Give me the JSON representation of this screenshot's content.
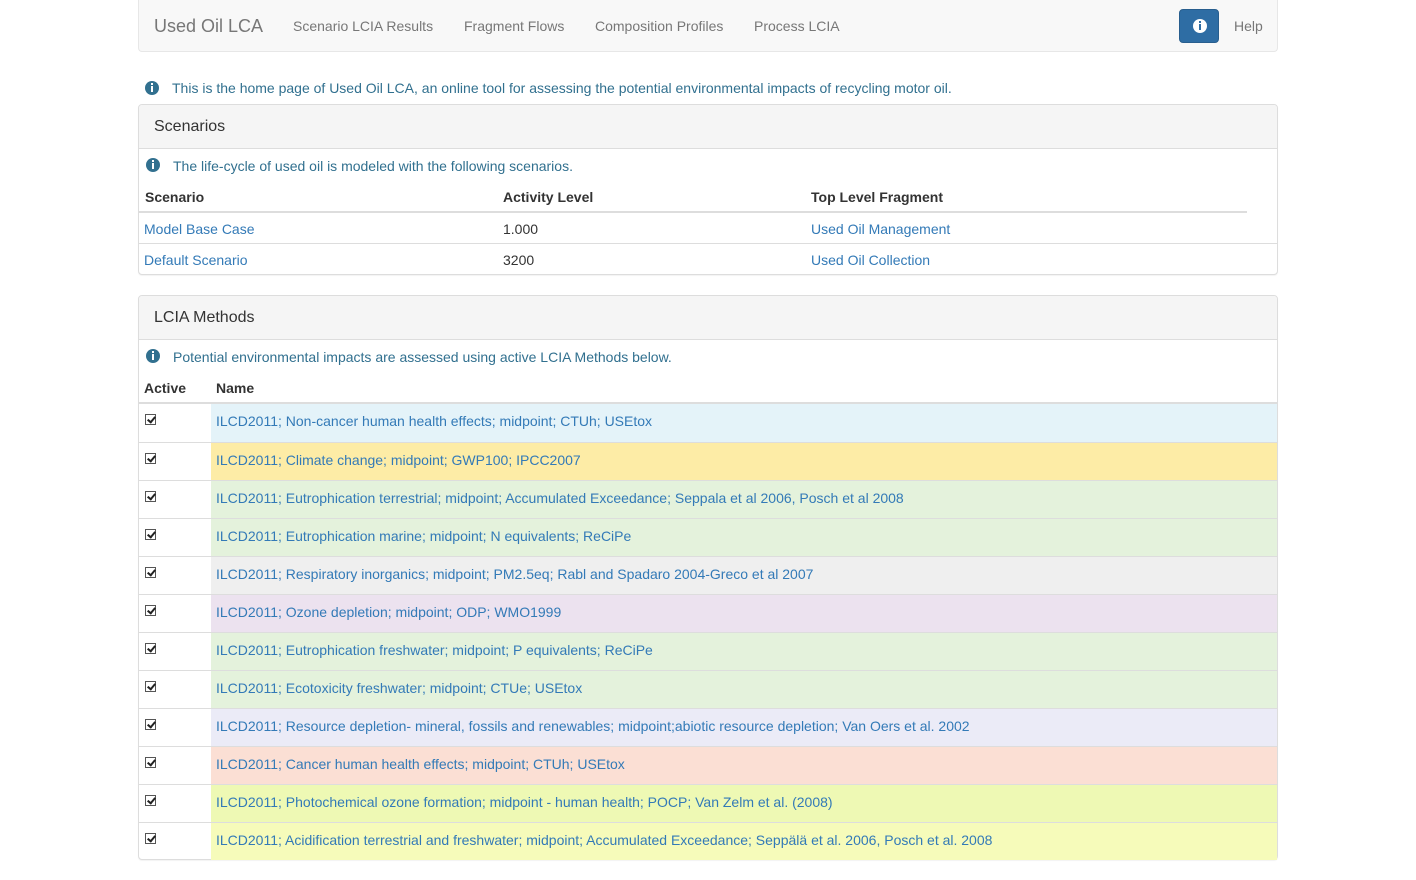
{
  "navbar": {
    "brand": "Used Oil LCA",
    "links": [
      "Scenario LCIA Results",
      "Fragment Flows",
      "Composition Profiles",
      "Process LCIA"
    ],
    "help": "Help",
    "info_icon": "info-sign-icon"
  },
  "intro": "This is the home page of Used Oil LCA, an online tool for assessing the potential environmental impacts of recycling motor oil.",
  "scenarios": {
    "title": "Scenarios",
    "note": "The life-cycle of used oil is modeled with the following scenarios.",
    "headers": [
      "Scenario",
      "Activity Level",
      "Top Level Fragment"
    ],
    "rows": [
      {
        "scenario": "Model Base Case",
        "activity": "1.000",
        "fragment": "Used Oil Management"
      },
      {
        "scenario": "Default Scenario",
        "activity": "3200",
        "fragment": "Used Oil Collection"
      }
    ]
  },
  "lcia": {
    "title": "LCIA Methods",
    "note": "Potential environmental impacts are assessed using active LCIA Methods below.",
    "headers": [
      "Active",
      "Name"
    ],
    "methods": [
      {
        "name": "ILCD2011; Non-cancer human health effects; midpoint; CTUh; USEtox",
        "active": true,
        "color": "#e4f3f9"
      },
      {
        "name": "ILCD2011; Climate change; midpoint; GWP100; IPCC2007",
        "active": true,
        "color": "#fdeca6"
      },
      {
        "name": "ILCD2011; Eutrophication terrestrial; midpoint; Accumulated Exceedance; Seppala et al 2006, Posch et al 2008",
        "active": true,
        "color": "#e4f2dc"
      },
      {
        "name": "ILCD2011; Eutrophication marine; midpoint; N equivalents; ReCiPe",
        "active": true,
        "color": "#e4f2dc"
      },
      {
        "name": "ILCD2011; Respiratory inorganics; midpoint; PM2.5eq; Rabl and Spadaro 2004-Greco et al 2007",
        "active": true,
        "color": "#efefef"
      },
      {
        "name": "ILCD2011; Ozone depletion; midpoint; ODP; WMO1999",
        "active": true,
        "color": "#ece2ef"
      },
      {
        "name": "ILCD2011; Eutrophication freshwater; midpoint; P equivalents; ReCiPe",
        "active": true,
        "color": "#e4f2dc"
      },
      {
        "name": "ILCD2011; Ecotoxicity freshwater; midpoint; CTUe; USEtox",
        "active": true,
        "color": "#e4f2dc"
      },
      {
        "name": "ILCD2011; Resource depletion- mineral, fossils and renewables; midpoint;abiotic resource depletion; Van Oers et al. 2002",
        "active": true,
        "color": "#ebebf7"
      },
      {
        "name": "ILCD2011; Cancer human health effects; midpoint; CTUh; USEtox",
        "active": true,
        "color": "#fbdfd4"
      },
      {
        "name": "ILCD2011; Photochemical ozone formation; midpoint - human health; POCP; Van Zelm et al. (2008)",
        "active": true,
        "color": "#eef9b4"
      },
      {
        "name": "ILCD2011; Acidification terrestrial and freshwater; midpoint; Accumulated Exceedance; Seppälä et al. 2006, Posch et al. 2008",
        "active": true,
        "color": "#f6fbba"
      }
    ]
  }
}
